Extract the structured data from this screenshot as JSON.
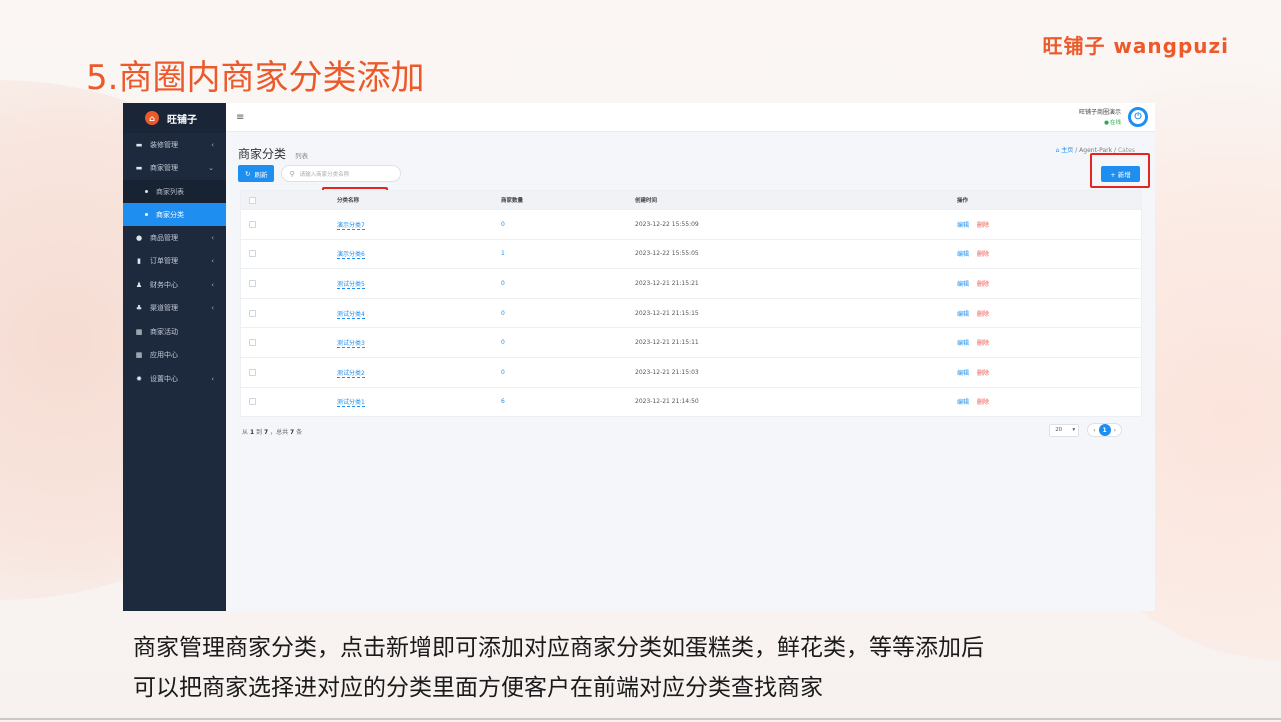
{
  "slide": {
    "title": "5.商圈内商家分类添加",
    "brand_cn": "旺铺子",
    "brand_en": "wangpuzi",
    "caption_line1": "商家管理商家分类，点击新增即可添加对应商家分类如蛋糕类，鲜花类，等等添加后",
    "caption_line2": "可以把商家选择进对应的分类里面方便客户在前端对应分类查找商家"
  },
  "sidebar": {
    "logo_text": "旺铺子",
    "items": [
      {
        "label": "装修管理",
        "icon": "shop-icon",
        "arrow": "‹"
      },
      {
        "label": "商家管理",
        "icon": "shop-icon",
        "arrow": "⌄"
      },
      {
        "label": "商家列表",
        "sub": true
      },
      {
        "label": "商家分类",
        "sub": true,
        "active": true
      },
      {
        "label": "商品管理",
        "icon": "goods-icon",
        "arrow": "‹"
      },
      {
        "label": "订单管理",
        "icon": "order-icon",
        "arrow": "‹"
      },
      {
        "label": "财务中心",
        "icon": "finance-icon",
        "arrow": "‹"
      },
      {
        "label": "渠道管理",
        "icon": "channel-icon",
        "arrow": "‹"
      },
      {
        "label": "商家活动",
        "icon": "grid-icon",
        "arrow": ""
      },
      {
        "label": "应用中心",
        "icon": "grid-icon",
        "arrow": ""
      },
      {
        "label": "设置中心",
        "icon": "gear-icon",
        "arrow": "‹"
      }
    ]
  },
  "topbar": {
    "menu_glyph": "≡",
    "user_name": "旺铺子商圈演示",
    "user_status": "在线"
  },
  "page": {
    "title": "商家分类",
    "subtitle": "列表",
    "breadcrumb_home": "主页",
    "breadcrumb_sep": "/",
    "breadcrumb_mid": "Agent-Park",
    "breadcrumb_cur": "Cates"
  },
  "toolbar": {
    "refresh_label": "刷新",
    "search_placeholder": "请输入商家分类名称",
    "add_label": "+ 新增"
  },
  "table": {
    "headers": {
      "name": "分类名称",
      "count": "商家数量",
      "time": "创建时间",
      "ops": "操作"
    },
    "edit_label": "编辑",
    "delete_label": "删除",
    "rows": [
      {
        "name": "演示分类7",
        "count": "0",
        "time": "2023-12-22 15:55:09"
      },
      {
        "name": "演示分类6",
        "count": "1",
        "time": "2023-12-22 15:55:05"
      },
      {
        "name": "测试分类5",
        "count": "0",
        "time": "2023-12-21 21:15:21"
      },
      {
        "name": "测试分类4",
        "count": "0",
        "time": "2023-12-21 21:15:15"
      },
      {
        "name": "测试分类3",
        "count": "0",
        "time": "2023-12-21 21:15:11"
      },
      {
        "name": "测试分类2",
        "count": "0",
        "time": "2023-12-21 21:15:03"
      },
      {
        "name": "测试分类1",
        "count": "6",
        "time": "2023-12-21 21:14:50"
      }
    ]
  },
  "pagination": {
    "info_prefix": "从",
    "info_from": "1",
    "info_mid": "到",
    "info_to": "7",
    "info_total_prefix": "，总共",
    "info_total": "7",
    "info_suffix": "条",
    "page_size": "20",
    "prev": "‹",
    "current": "1",
    "next": "›"
  },
  "colors": {
    "accent": "#1e8ff0",
    "brand": "#ec5a2b",
    "highlight": "#e5251f",
    "danger": "#f0544a"
  }
}
